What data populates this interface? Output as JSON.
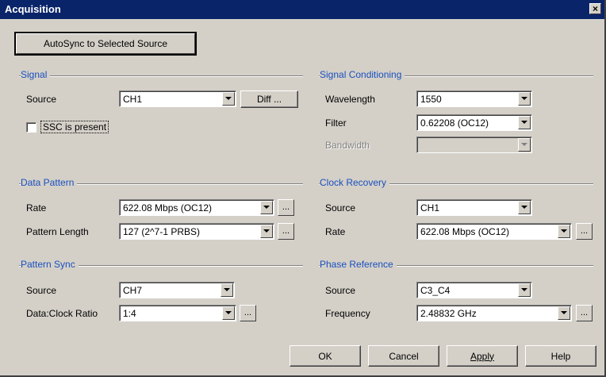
{
  "window": {
    "title": "Acquisition",
    "close_label": "×"
  },
  "autosync_button": {
    "label": "AutoSync to Selected Source"
  },
  "signal": {
    "title": "Signal",
    "source_label": "Source",
    "source_value": "CH1",
    "diff_button": "Diff ...",
    "ssc_label": "SSC is present",
    "ssc_checked": false
  },
  "signal_conditioning": {
    "title": "Signal Conditioning",
    "wavelength_label": "Wavelength",
    "wavelength_value": "1550",
    "filter_label": "Filter",
    "filter_value": "0.62208 (OC12)",
    "bandwidth_label": "Bandwidth",
    "bandwidth_value": ""
  },
  "data_pattern": {
    "title": "Data Pattern",
    "rate_label": "Rate",
    "rate_value": "622.08 Mbps (OC12)",
    "pattern_length_label": "Pattern Length",
    "pattern_length_value": "127 (2^7-1 PRBS)",
    "ellipsis": "..."
  },
  "clock_recovery": {
    "title": "Clock Recovery",
    "source_label": "Source",
    "source_value": "CH1",
    "rate_label": "Rate",
    "rate_value": "622.08 Mbps (OC12)",
    "ellipsis": "..."
  },
  "pattern_sync": {
    "title": "Pattern Sync",
    "source_label": "Source",
    "source_value": "CH7",
    "ratio_label": "Data:Clock Ratio",
    "ratio_value": "1:4",
    "ellipsis": "..."
  },
  "phase_reference": {
    "title": "Phase Reference",
    "source_label": "Source",
    "source_value": "C3_C4",
    "frequency_label": "Frequency",
    "frequency_value": "2.48832 GHz",
    "ellipsis": "..."
  },
  "footer": {
    "ok": "OK",
    "cancel": "Cancel",
    "apply": "Apply",
    "help": "Help"
  }
}
